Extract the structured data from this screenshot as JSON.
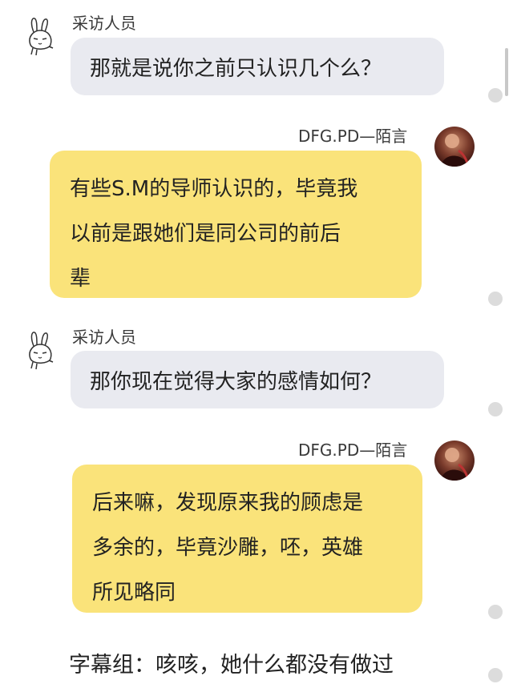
{
  "messages": [
    {
      "sender": "采访人员",
      "side": "left",
      "lines": [
        "那就是说你之前只认识几个么？"
      ]
    },
    {
      "sender": "DFG.PD—陌言",
      "side": "right",
      "lines": [
        "有些S.M的导师认识的，毕竟我",
        "以前是跟她们是同公司的前后",
        "辈"
      ]
    },
    {
      "sender": "采访人员",
      "side": "left",
      "lines": [
        "那你现在觉得大家的感情如何？"
      ]
    },
    {
      "sender": "DFG.PD—陌言",
      "side": "right",
      "lines": [
        "后来嘛，发现原来我的顾虑是",
        "多余的，毕竟沙雕，呸，英雄",
        "所见略同"
      ]
    }
  ],
  "caption": "字幕组：咳咳，她什么都没有做过",
  "colors": {
    "left_bubble": "#e9eaf0",
    "right_bubble": "#fae37a",
    "background": "#ffffff"
  },
  "icons": {
    "left_avatar": "rabbit-doodle-icon",
    "right_avatar": "user-photo-avatar"
  }
}
